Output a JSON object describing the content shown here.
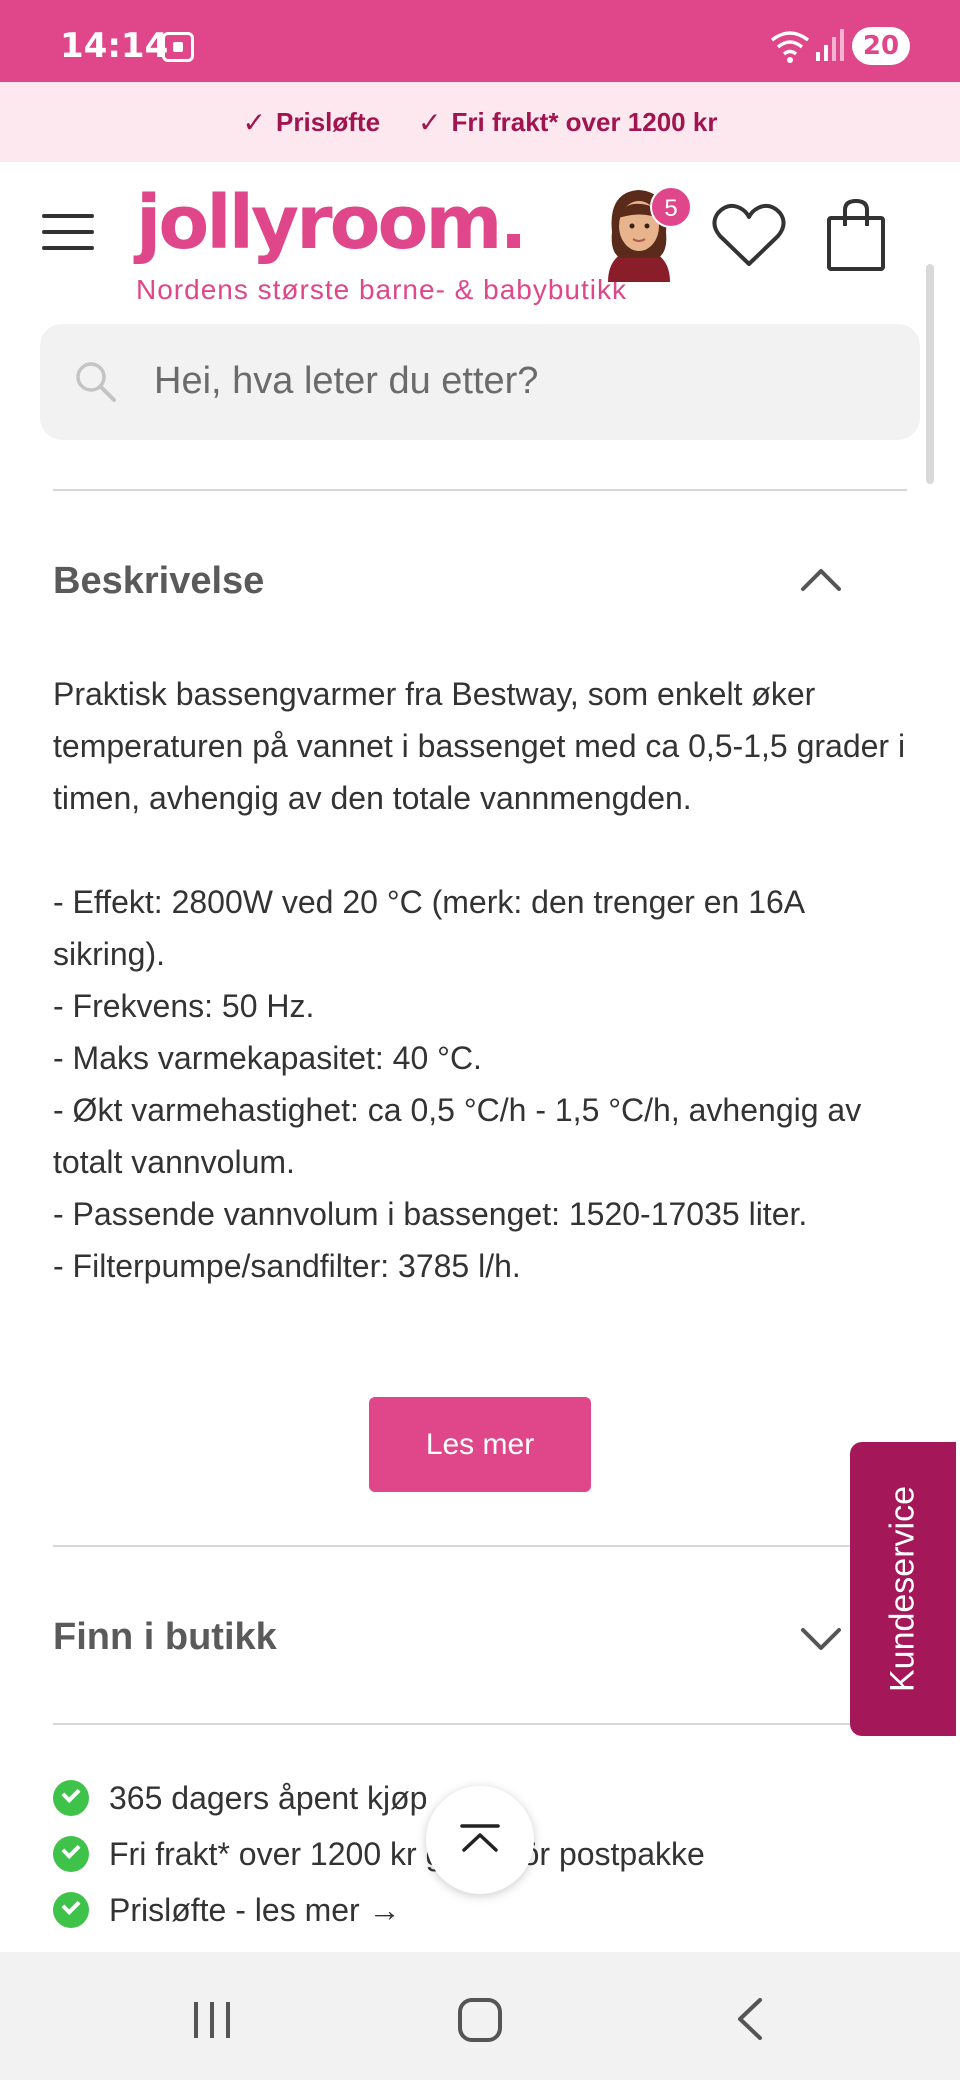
{
  "status_bar": {
    "time": "14:14",
    "battery": "20"
  },
  "promo": {
    "items": [
      {
        "icon": "checkmark-icon",
        "label": "Prisløfte"
      },
      {
        "icon": "checkmark-icon",
        "label": "Fri frakt* over 1200 kr"
      }
    ]
  },
  "header": {
    "logo": "jollyroom.",
    "tagline": "Nordens største barne- & babybutikk",
    "avatar_badge": "5"
  },
  "search": {
    "placeholder": "Hei, hva leter du etter?"
  },
  "description": {
    "title": "Beskrivelse",
    "intro": "Praktisk bassengvarmer fra Bestway, som enkelt øker temperaturen på vannet i bassenget med ca 0,5-1,5 grader i timen, avhengig av den totale vannmengden.",
    "specs": [
      "- Effekt: 2800W ved 20 °C (merk: den trenger en 16A sikring).",
      "- Frekvens: 50 Hz.",
      "- Maks varmekapasitet: 40 °C.",
      "- Økt varmehastighet: ca 0,5 °C/h - 1,5 °C/h, avhengig av totalt vannvolum.",
      "- Passende vannvolum i bassenget: 1520-17035 liter.",
      "- Filterpumpe/sandfilter: 3785 l/h."
    ],
    "read_more": "Les mer"
  },
  "store": {
    "title": "Finn i butikk"
  },
  "usps": [
    "365 dagers åpent kjøp",
    "Fri frakt* over 1200 kr gäller för postpakke",
    "Prisløfte - les mer →"
  ],
  "customer_service": "Kundeservice",
  "colors": {
    "brand": "#e0468a",
    "brand_dark": "#a4185a",
    "promo_bg": "#fde8ef",
    "check_green": "#3ec24a"
  }
}
